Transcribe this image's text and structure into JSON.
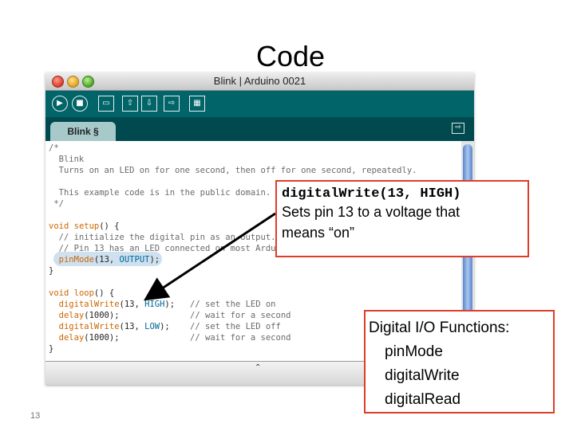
{
  "slide": {
    "title": "Code",
    "page_number": "13"
  },
  "window": {
    "title": "Blink | Arduino 0021"
  },
  "toolbar": {
    "buttons": [
      {
        "name": "verify-button",
        "icon": "play-icon",
        "glyph": "▶"
      },
      {
        "name": "stop-button",
        "icon": "stop-icon",
        "glyph": "■"
      },
      {
        "name": "new-button",
        "icon": "new-file-icon",
        "glyph": "▭"
      },
      {
        "name": "open-button",
        "icon": "open-icon",
        "glyph": "⇧"
      },
      {
        "name": "save-button",
        "icon": "save-icon",
        "glyph": "⇩"
      },
      {
        "name": "upload-button",
        "icon": "upload-icon",
        "glyph": "⇨"
      },
      {
        "name": "serial-monitor-button",
        "icon": "serial-monitor-icon",
        "glyph": "▦"
      }
    ]
  },
  "tab": {
    "label": "Blink §",
    "arrow_glyph": "⇨"
  },
  "code": {
    "l1": "/*",
    "l2": "  Blink",
    "l3": "  Turns on an LED on for one second, then off for one second, repeatedly.",
    "l5": "  This example code is in the public domain.",
    "l6": " */",
    "s1": "void",
    "s2": " ",
    "s3": "setup",
    "s4": "() {",
    "c1": "  // initialize the digital pin as an output.",
    "c2": "  // Pin 13 has an LED connected on most Arduino boards:",
    "p1": "  ",
    "p2": "pinMode",
    "p3": "(13, ",
    "p4": "OUTPUT",
    "p5": ");",
    "close": "}",
    "o1": "void",
    "o2": " ",
    "o3": "loop",
    "o4": "() {",
    "w1": "  ",
    "w2": "digitalWrite",
    "w3": "(13, ",
    "w4": "HIGH",
    "w5": ");",
    "w6": "   // set the LED on",
    "d1": "  ",
    "d2": "delay",
    "d3": "(1000);",
    "d4": "              // wait for a second",
    "x1": "  ",
    "x2": "digitalWrite",
    "x3": "(13, ",
    "x4": "LOW",
    "x5": ");",
    "x6": "    // set the LED off",
    "e1": "  ",
    "e2": "delay",
    "e3": "(1000);",
    "e4": "              // wait for a second"
  },
  "callout_write": {
    "code": "digitalWrite(13, HIGH)",
    "line1": "Sets pin 13 to a voltage that",
    "line2": "means “on”"
  },
  "callout_io": {
    "title": "Digital I/O Functions:",
    "items": [
      "pinMode",
      "digitalWrite",
      "digitalRead"
    ]
  },
  "status": {
    "splitter_glyph": "⌃"
  },
  "colors": {
    "toolbar": "#006468",
    "tabbar": "#004a4f",
    "callout_border": "#e03c2a",
    "keyword": "#cc6600",
    "constant": "#006699"
  }
}
